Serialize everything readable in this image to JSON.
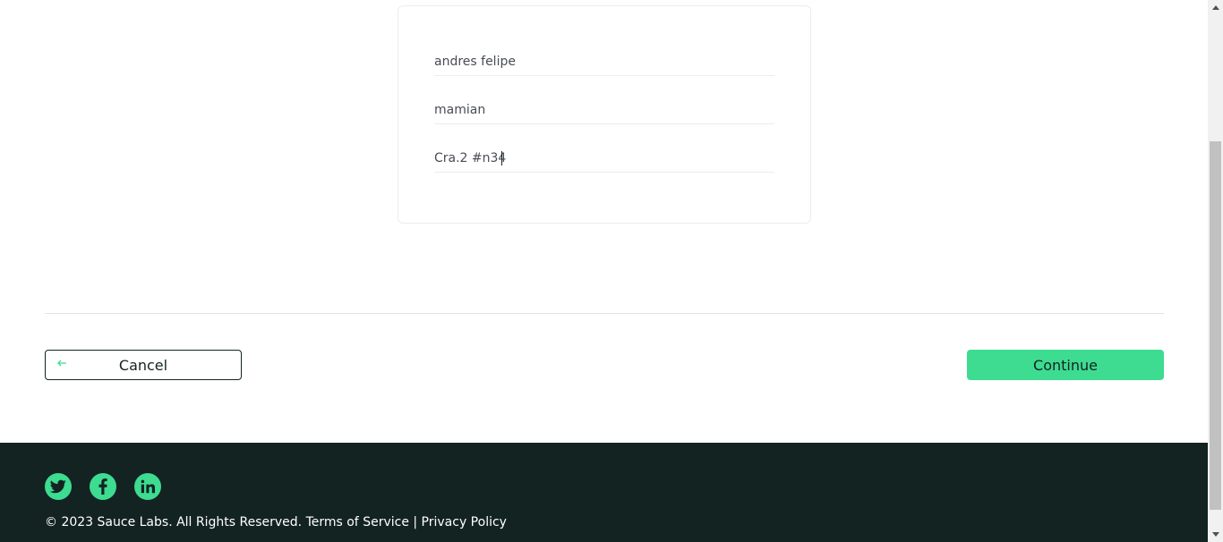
{
  "form": {
    "first_name_value": "andres felipe",
    "last_name_value": "mamian",
    "postal_code_value": "Cra.2 #n34"
  },
  "actions": {
    "cancel_label": "Cancel",
    "continue_label": "Continue"
  },
  "footer": {
    "copyright": "© 2023 Sauce Labs. All Rights Reserved. Terms of Service | Privacy Policy",
    "social": [
      "twitter-icon",
      "facebook-icon",
      "linkedin-icon"
    ]
  },
  "colors": {
    "accent": "#3ddc91",
    "dark": "#132322"
  }
}
